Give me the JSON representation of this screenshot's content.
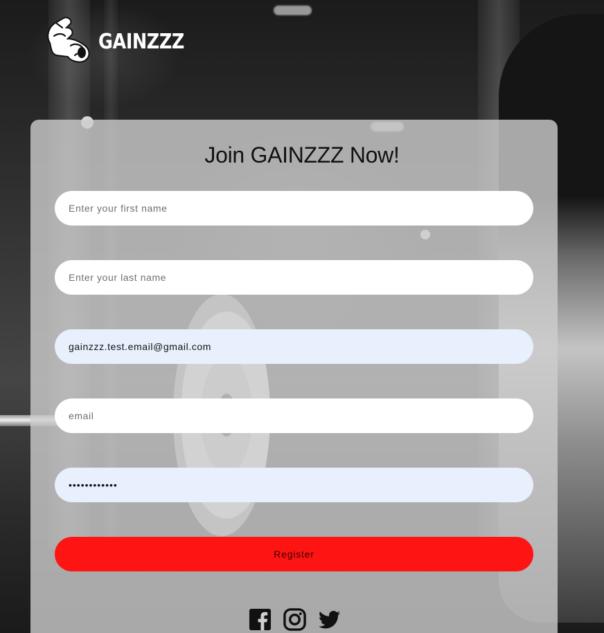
{
  "brand": {
    "name": "GAINZZZ",
    "logo_icon": "flexed-arm-icon"
  },
  "form": {
    "title": "Join GAINZZZ Now!",
    "first_name": {
      "placeholder": "Enter your first name",
      "value": ""
    },
    "last_name": {
      "placeholder": "Enter your last name",
      "value": ""
    },
    "email_autofill": {
      "value": "gainzzz.test.email@gmail.com"
    },
    "email": {
      "placeholder": "email",
      "value": ""
    },
    "password": {
      "value": "••••••••••••"
    },
    "register_label": "Register"
  },
  "social": [
    {
      "name": "facebook",
      "icon": "facebook-icon"
    },
    {
      "name": "instagram",
      "icon": "instagram-icon"
    },
    {
      "name": "twitter",
      "icon": "twitter-icon"
    }
  ],
  "colors": {
    "register_button": "#ff1414",
    "autofill_field": "#e8f0fe",
    "card": "rgba(205,205,205,0.80)"
  }
}
